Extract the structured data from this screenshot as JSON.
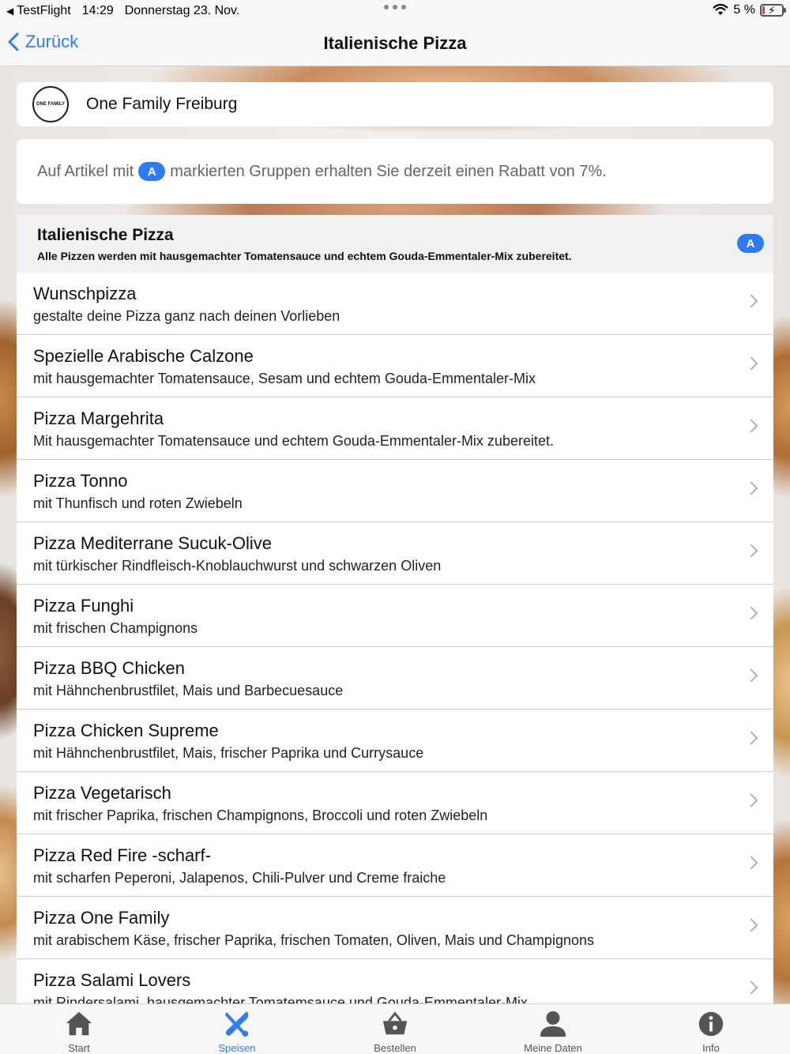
{
  "status_bar": {
    "back_app": "TestFlight",
    "time": "14:29",
    "date": "Donnerstag 23. Nov.",
    "battery": "5 %"
  },
  "nav": {
    "back_label": "Zurück",
    "title": "Italienische Pizza"
  },
  "restaurant": {
    "name": "One Family Freiburg",
    "logo_text": "ONE FAMILY"
  },
  "notice": {
    "before": "Auf Artikel mit",
    "badge": "A",
    "after": "markierten Gruppen erhalten Sie derzeit einen Rabatt von 7%."
  },
  "group": {
    "title": "Italienische Pizza",
    "description": "Alle Pizzen werden mit hausgemachter Tomatensauce und echtem Gouda-Emmentaler-Mix zubereitet.",
    "badge": "A"
  },
  "items": [
    {
      "name": "Wunschpizza",
      "desc": "gestalte deine Pizza ganz nach deinen Vorlieben"
    },
    {
      "name": "Spezielle Arabische Calzone",
      "desc": "mit hausgemachter Tomatensauce, Sesam und echtem Gouda-Emmentaler-Mix"
    },
    {
      "name": "Pizza Margehrita",
      "desc": "Mit hausgemachter Tomatensauce und echtem Gouda-Emmentaler-Mix zubereitet."
    },
    {
      "name": "Pizza Tonno",
      "desc": "mit Thunfisch und roten Zwiebeln"
    },
    {
      "name": "Pizza Mediterrane Sucuk-Olive",
      "desc": "mit türkischer Rindfleisch-Knoblauchwurst und schwarzen Oliven"
    },
    {
      "name": "Pizza Funghi",
      "desc": "mit frischen Champignons"
    },
    {
      "name": "Pizza BBQ Chicken",
      "desc": "mit Hähnchenbrustfilet, Mais und Barbecuesauce"
    },
    {
      "name": "Pizza Chicken Supreme",
      "desc": "mit Hähnchenbrustfilet, Mais, frischer Paprika und Currysauce"
    },
    {
      "name": "Pizza Vegetarisch",
      "desc": "mit frischer Paprika, frischen Champignons, Broccoli und roten Zwiebeln"
    },
    {
      "name": "Pizza Red Fire -scharf-",
      "desc": "mit scharfen Peperoni, Jalapenos, Chili-Pulver und Creme fraiche"
    },
    {
      "name": "Pizza One Family",
      "desc": "mit arabischem Käse, frischer Paprika, frischen Tomaten, Oliven, Mais und Champignons"
    },
    {
      "name": "Pizza Salami Lovers",
      "desc": "mit Rindersalami, hausgemachter Tomatemsauce und Gouda-Emmentaler-Mix"
    }
  ],
  "tabs": [
    {
      "label": "Start",
      "icon": "home-icon"
    },
    {
      "label": "Speisen",
      "icon": "cutlery-icon",
      "active": true
    },
    {
      "label": "Bestellen",
      "icon": "basket-icon"
    },
    {
      "label": "Meine Daten",
      "icon": "person-icon"
    },
    {
      "label": "Info",
      "icon": "info-icon"
    }
  ],
  "colors": {
    "accent": "#2f7bf5",
    "battery_low": "#e53935"
  }
}
